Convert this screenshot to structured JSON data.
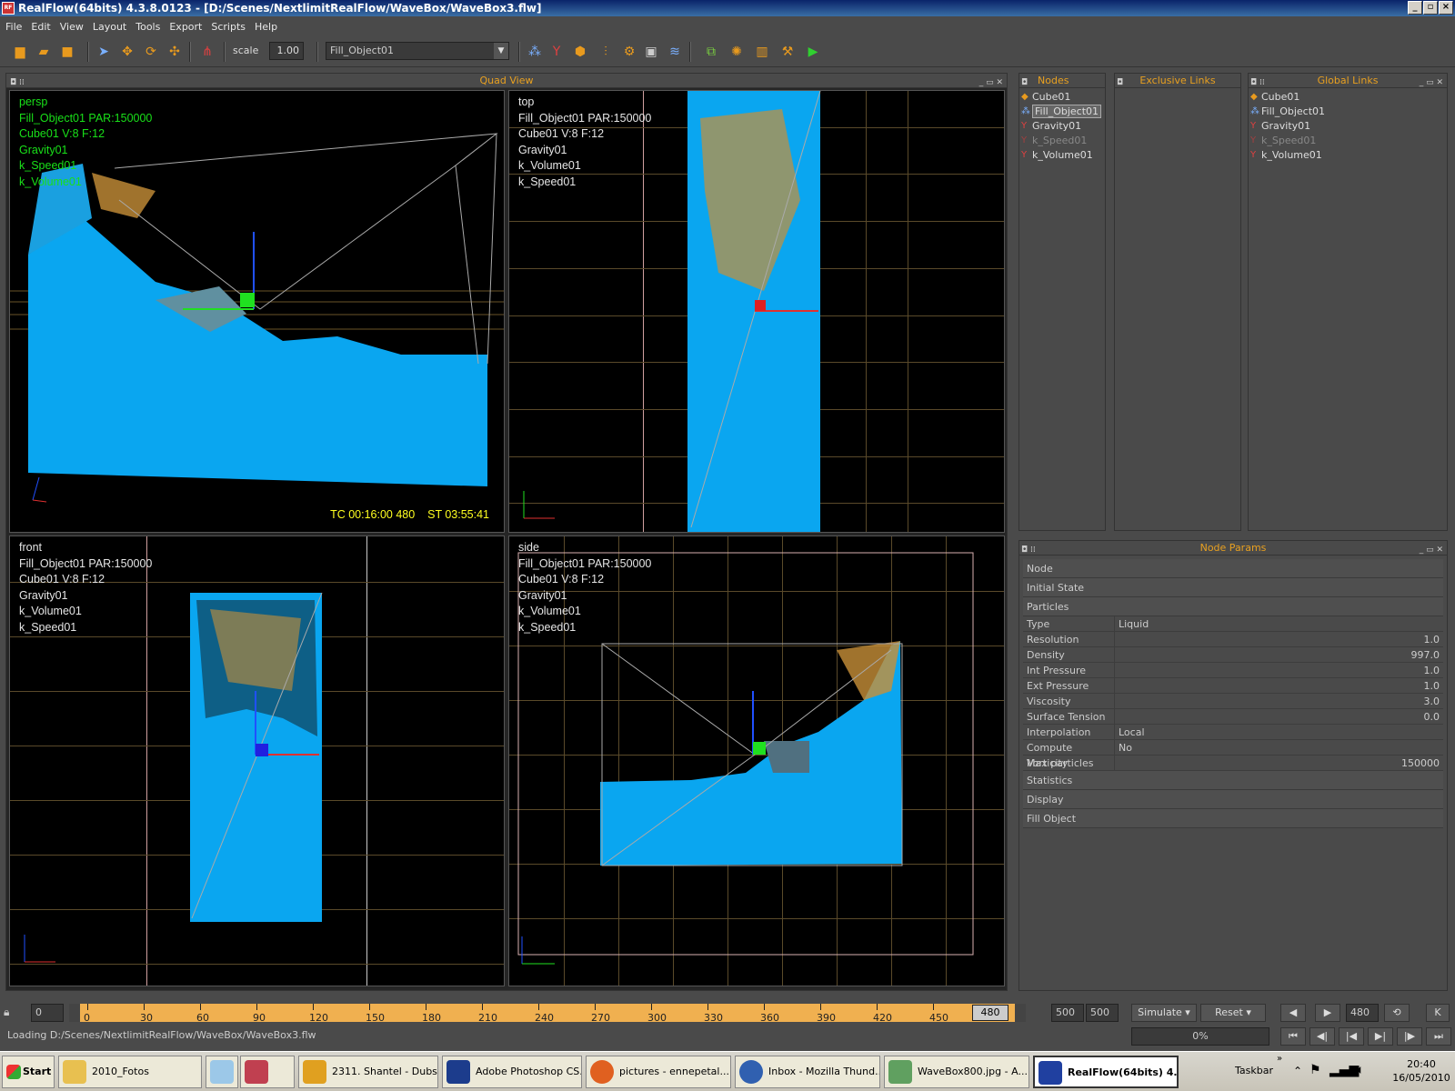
{
  "window": {
    "title": "RealFlow(64bits) 4.3.8.0123 - [D:/Scenes/NextlimitRealFlow/WaveBox/WaveBox3.flw]"
  },
  "menu": [
    "File",
    "Edit",
    "View",
    "Layout",
    "Tools",
    "Export",
    "Scripts",
    "Help"
  ],
  "toolbar": {
    "scale_label": "scale",
    "scale_value": "1.00",
    "object_select": "Fill_Object01"
  },
  "quad": {
    "title": "Quad View",
    "persp": {
      "view": "persp",
      "lines": [
        "Fill_Object01 PAR:150000",
        "Cube01 V:8 F:12",
        "Gravity01",
        "k_Speed01",
        "k_Volume01"
      ],
      "timecode": "TC 00:16:00 480",
      "simtime": "ST 03:55:41"
    },
    "top": {
      "view": "top",
      "lines": [
        "Fill_Object01 PAR:150000",
        "Cube01 V:8 F:12",
        "Gravity01",
        "k_Volume01",
        "k_Speed01"
      ]
    },
    "front": {
      "view": "front",
      "lines": [
        "Fill_Object01 PAR:150000",
        "Cube01 V:8 F:12",
        "Gravity01",
        "k_Volume01",
        "k_Speed01"
      ]
    },
    "side": {
      "view": "side",
      "lines": [
        "Fill_Object01 PAR:150000",
        "Cube01 V:8 F:12",
        "Gravity01",
        "k_Volume01",
        "k_Speed01"
      ]
    }
  },
  "nodes": {
    "title": "Nodes",
    "items": [
      "Cube01",
      "Fill_Object01",
      "Gravity01",
      "k_Speed01",
      "k_Volume01"
    ]
  },
  "exclusive_links": {
    "title": "Exclusive Links"
  },
  "global_links": {
    "title": "Global Links",
    "items": [
      "Cube01",
      "Fill_Object01",
      "Gravity01",
      "k_Speed01",
      "k_Volume01"
    ]
  },
  "node_params": {
    "title": "Node Params",
    "sections_top": [
      "Node",
      "Initial State",
      "Particles"
    ],
    "rows": [
      {
        "label": "Type",
        "value": "Liquid"
      },
      {
        "label": "Resolution",
        "value": "1.0"
      },
      {
        "label": "Density",
        "value": "997.0"
      },
      {
        "label": "Int Pressure",
        "value": "1.0"
      },
      {
        "label": "Ext Pressure",
        "value": "1.0"
      },
      {
        "label": "Viscosity",
        "value": "3.0"
      },
      {
        "label": "Surface Tension",
        "value": "0.0"
      },
      {
        "label": "Interpolation",
        "value": "Local"
      },
      {
        "label": "Compute Vorticity",
        "value": "No"
      },
      {
        "label": "Max particles",
        "value": "150000"
      }
    ],
    "sections_bottom": [
      "Statistics",
      "Display",
      "Fill Object"
    ]
  },
  "timeline": {
    "start_field": "0",
    "ticks": [
      "0",
      "30",
      "60",
      "90",
      "120",
      "150",
      "180",
      "210",
      "240",
      "270",
      "300",
      "330",
      "360",
      "390",
      "420",
      "450"
    ],
    "current": "480",
    "end1": "500",
    "end2": "500",
    "simulate": "Simulate",
    "reset": "Reset",
    "frame": "480",
    "k": "K",
    "progress": "0%"
  },
  "status": {
    "text": "Loading D:/Scenes/NextlimitRealFlow/WaveBox/WaveBox3.flw"
  },
  "taskbar": {
    "start": "Start",
    "tasks": [
      "2010_Fotos",
      "2311. Shantel - Dubs...",
      "Adobe Photoshop CS...",
      "pictures - ennepetal...",
      "Inbox - Mozilla Thund...",
      "WaveBox800.jpg - A...",
      "RealFlow(64bits) 4..."
    ],
    "label": "Taskbar",
    "time": "20:40",
    "date": "16/05/2010"
  }
}
